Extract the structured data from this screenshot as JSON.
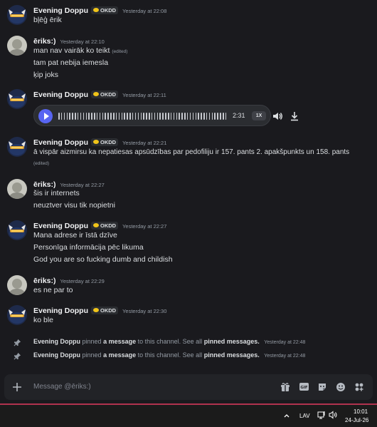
{
  "messages": [
    {
      "author": "Evening Doppu",
      "tag": "OKDD",
      "time": "Yesterday at 22:08",
      "lines": [
        "bļēģ ērik"
      ]
    },
    {
      "author": "ēriks:)",
      "time": "Yesterday at 22:10",
      "lines": [
        "man nav vairāk ko teikt",
        "tam pat nebija iemesla",
        "ķip joks"
      ],
      "edited": "(edited)"
    },
    {
      "author": "Evening Doppu",
      "tag": "OKDD",
      "time": "Yesterday at 22:11",
      "audio": {
        "duration": "2:31",
        "speed": "1X"
      }
    },
    {
      "author": "Evening Doppu",
      "tag": "OKDD",
      "time": "Yesterday at 22:21",
      "lines": [
        "ā vispār aizmirsu ka nepatiesas apsūdzības par pedofiliju ir 157. pants 2. apakšpunkts un 158. pants"
      ],
      "edited": "(edited)"
    },
    {
      "author": "ēriks:)",
      "time": "Yesterday at 22:27",
      "lines": [
        "šis ir internets",
        "neuztver visu tik nopietni"
      ]
    },
    {
      "author": "Evening Doppu",
      "tag": "OKDD",
      "time": "Yesterday at 22:27",
      "lines": [
        "Mana adrese ir īstā dzīve",
        "Personīga informācija pēc likuma",
        "God you are so fucking dumb and childish"
      ]
    },
    {
      "author": "ēriks:)",
      "time": "Yesterday at 22:29",
      "lines": [
        "es ne par to"
      ]
    },
    {
      "author": "Evening Doppu",
      "tag": "OKDD",
      "time": "Yesterday at 22:30",
      "lines": [
        "ko ble"
      ]
    }
  ],
  "system_messages": [
    {
      "author": "Evening Doppu",
      "pre": "pinned",
      "link": "a message",
      "mid": "to this channel. See all",
      "link2": "pinned messages.",
      "time": "Yesterday at 22:48"
    },
    {
      "author": "Evening Doppu",
      "pre": "pinned",
      "link": "a message",
      "mid": "to this channel. See all",
      "link2": "pinned messages.",
      "time": "Yesterday at 22:48"
    }
  ],
  "composer": {
    "placeholder": "Message @ēriks:)",
    "gif_label": "GIF"
  },
  "taskbar": {
    "language": "LAV",
    "clock_time": "10:01",
    "clock_date": "24-Jul-26"
  },
  "colors": {
    "accent": "#5865f2",
    "background": "#1a1a1e",
    "tag_badge": "#f0c419",
    "window_border": "#b0324e"
  },
  "icons": [
    "gift-icon",
    "gif-icon",
    "sticker-icon",
    "emoji-icon",
    "apps-icon",
    "pin-icon",
    "speaker-icon",
    "download-icon",
    "chevron-up-icon",
    "network-icon",
    "volume-icon"
  ]
}
